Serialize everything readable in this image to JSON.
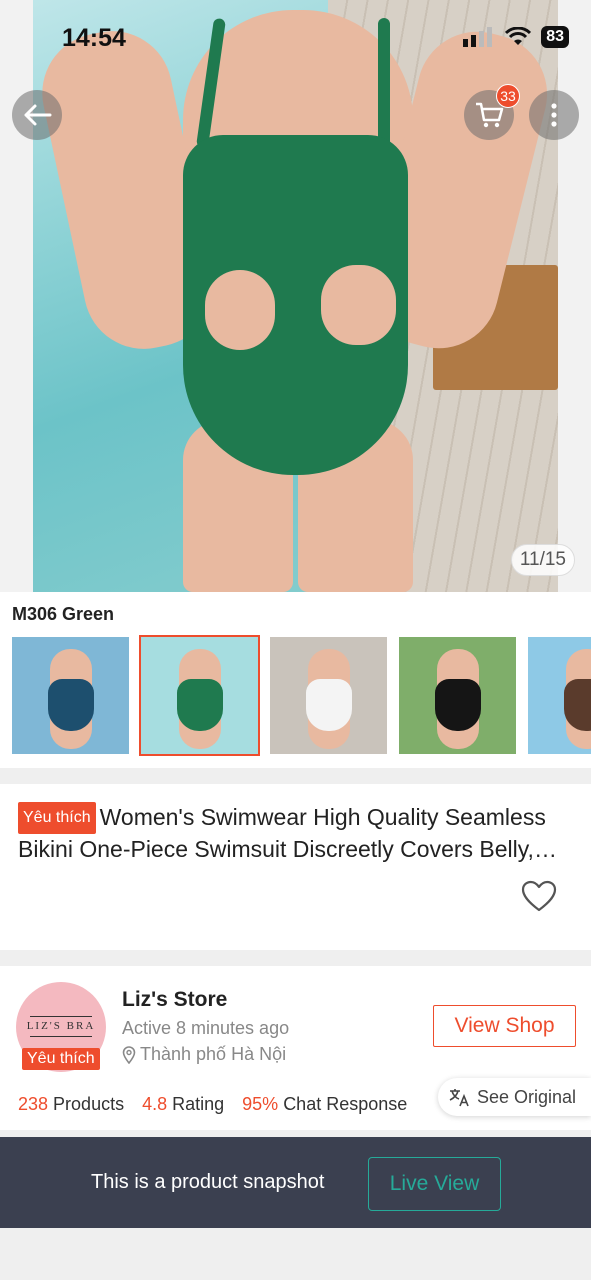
{
  "status_bar": {
    "time": "14:54",
    "battery": "83"
  },
  "gallery": {
    "counter": "11/15"
  },
  "header": {
    "cart_count": "33"
  },
  "variant": {
    "name": "M306 Green",
    "thumbnails": [
      {
        "color": "#1d4f6e",
        "bg": "#7fb7d6"
      },
      {
        "color": "#1f7a4f",
        "bg": "#a6dde0"
      },
      {
        "color": "#f4f4f4",
        "bg": "#c9c3bb"
      },
      {
        "color": "#151515",
        "bg": "#7fae6a"
      },
      {
        "color": "#5a3b2c",
        "bg": "#8ec9e6"
      }
    ]
  },
  "product": {
    "tag": "Yêu thích",
    "title": "Women's Swimwear High Quality Seamless Bikini One-Piece Swimsuit Discreetly Covers Belly, Slim Fit"
  },
  "shop": {
    "name": "Liz's Store",
    "logo_text": "LIZ'S BRA",
    "tag": "Yêu thích",
    "active": "Active 8 minutes ago",
    "location": "Thành phố Hà Nội",
    "view_shop_label": "View Shop",
    "stats": [
      {
        "num": "238",
        "label": "Products"
      },
      {
        "num": "4.8",
        "label": "Rating"
      },
      {
        "num": "95%",
        "label": "Chat Response"
      }
    ],
    "see_original": "See Original"
  },
  "snapshot": {
    "text": "This is a product snapshot",
    "live_view_label": "Live View"
  },
  "colors": {
    "accent": "#ee4d2d",
    "teal": "#26aa99",
    "bar": "#3b4050"
  }
}
